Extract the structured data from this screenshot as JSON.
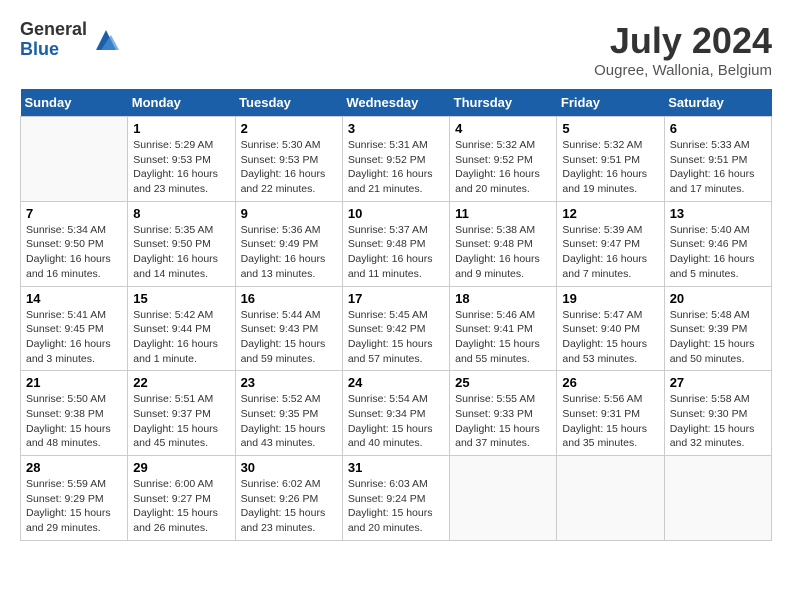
{
  "logo": {
    "general": "General",
    "blue": "Blue"
  },
  "header": {
    "title": "July 2024",
    "subtitle": "Ougree, Wallonia, Belgium"
  },
  "days_of_week": [
    "Sunday",
    "Monday",
    "Tuesday",
    "Wednesday",
    "Thursday",
    "Friday",
    "Saturday"
  ],
  "weeks": [
    [
      {
        "day": "",
        "sunrise": "",
        "sunset": "",
        "daylight": ""
      },
      {
        "day": "1",
        "sunrise": "Sunrise: 5:29 AM",
        "sunset": "Sunset: 9:53 PM",
        "daylight": "Daylight: 16 hours and 23 minutes."
      },
      {
        "day": "2",
        "sunrise": "Sunrise: 5:30 AM",
        "sunset": "Sunset: 9:53 PM",
        "daylight": "Daylight: 16 hours and 22 minutes."
      },
      {
        "day": "3",
        "sunrise": "Sunrise: 5:31 AM",
        "sunset": "Sunset: 9:52 PM",
        "daylight": "Daylight: 16 hours and 21 minutes."
      },
      {
        "day": "4",
        "sunrise": "Sunrise: 5:32 AM",
        "sunset": "Sunset: 9:52 PM",
        "daylight": "Daylight: 16 hours and 20 minutes."
      },
      {
        "day": "5",
        "sunrise": "Sunrise: 5:32 AM",
        "sunset": "Sunset: 9:51 PM",
        "daylight": "Daylight: 16 hours and 19 minutes."
      },
      {
        "day": "6",
        "sunrise": "Sunrise: 5:33 AM",
        "sunset": "Sunset: 9:51 PM",
        "daylight": "Daylight: 16 hours and 17 minutes."
      }
    ],
    [
      {
        "day": "7",
        "sunrise": "Sunrise: 5:34 AM",
        "sunset": "Sunset: 9:50 PM",
        "daylight": "Daylight: 16 hours and 16 minutes."
      },
      {
        "day": "8",
        "sunrise": "Sunrise: 5:35 AM",
        "sunset": "Sunset: 9:50 PM",
        "daylight": "Daylight: 16 hours and 14 minutes."
      },
      {
        "day": "9",
        "sunrise": "Sunrise: 5:36 AM",
        "sunset": "Sunset: 9:49 PM",
        "daylight": "Daylight: 16 hours and 13 minutes."
      },
      {
        "day": "10",
        "sunrise": "Sunrise: 5:37 AM",
        "sunset": "Sunset: 9:48 PM",
        "daylight": "Daylight: 16 hours and 11 minutes."
      },
      {
        "day": "11",
        "sunrise": "Sunrise: 5:38 AM",
        "sunset": "Sunset: 9:48 PM",
        "daylight": "Daylight: 16 hours and 9 minutes."
      },
      {
        "day": "12",
        "sunrise": "Sunrise: 5:39 AM",
        "sunset": "Sunset: 9:47 PM",
        "daylight": "Daylight: 16 hours and 7 minutes."
      },
      {
        "day": "13",
        "sunrise": "Sunrise: 5:40 AM",
        "sunset": "Sunset: 9:46 PM",
        "daylight": "Daylight: 16 hours and 5 minutes."
      }
    ],
    [
      {
        "day": "14",
        "sunrise": "Sunrise: 5:41 AM",
        "sunset": "Sunset: 9:45 PM",
        "daylight": "Daylight: 16 hours and 3 minutes."
      },
      {
        "day": "15",
        "sunrise": "Sunrise: 5:42 AM",
        "sunset": "Sunset: 9:44 PM",
        "daylight": "Daylight: 16 hours and 1 minute."
      },
      {
        "day": "16",
        "sunrise": "Sunrise: 5:44 AM",
        "sunset": "Sunset: 9:43 PM",
        "daylight": "Daylight: 15 hours and 59 minutes."
      },
      {
        "day": "17",
        "sunrise": "Sunrise: 5:45 AM",
        "sunset": "Sunset: 9:42 PM",
        "daylight": "Daylight: 15 hours and 57 minutes."
      },
      {
        "day": "18",
        "sunrise": "Sunrise: 5:46 AM",
        "sunset": "Sunset: 9:41 PM",
        "daylight": "Daylight: 15 hours and 55 minutes."
      },
      {
        "day": "19",
        "sunrise": "Sunrise: 5:47 AM",
        "sunset": "Sunset: 9:40 PM",
        "daylight": "Daylight: 15 hours and 53 minutes."
      },
      {
        "day": "20",
        "sunrise": "Sunrise: 5:48 AM",
        "sunset": "Sunset: 9:39 PM",
        "daylight": "Daylight: 15 hours and 50 minutes."
      }
    ],
    [
      {
        "day": "21",
        "sunrise": "Sunrise: 5:50 AM",
        "sunset": "Sunset: 9:38 PM",
        "daylight": "Daylight: 15 hours and 48 minutes."
      },
      {
        "day": "22",
        "sunrise": "Sunrise: 5:51 AM",
        "sunset": "Sunset: 9:37 PM",
        "daylight": "Daylight: 15 hours and 45 minutes."
      },
      {
        "day": "23",
        "sunrise": "Sunrise: 5:52 AM",
        "sunset": "Sunset: 9:35 PM",
        "daylight": "Daylight: 15 hours and 43 minutes."
      },
      {
        "day": "24",
        "sunrise": "Sunrise: 5:54 AM",
        "sunset": "Sunset: 9:34 PM",
        "daylight": "Daylight: 15 hours and 40 minutes."
      },
      {
        "day": "25",
        "sunrise": "Sunrise: 5:55 AM",
        "sunset": "Sunset: 9:33 PM",
        "daylight": "Daylight: 15 hours and 37 minutes."
      },
      {
        "day": "26",
        "sunrise": "Sunrise: 5:56 AM",
        "sunset": "Sunset: 9:31 PM",
        "daylight": "Daylight: 15 hours and 35 minutes."
      },
      {
        "day": "27",
        "sunrise": "Sunrise: 5:58 AM",
        "sunset": "Sunset: 9:30 PM",
        "daylight": "Daylight: 15 hours and 32 minutes."
      }
    ],
    [
      {
        "day": "28",
        "sunrise": "Sunrise: 5:59 AM",
        "sunset": "Sunset: 9:29 PM",
        "daylight": "Daylight: 15 hours and 29 minutes."
      },
      {
        "day": "29",
        "sunrise": "Sunrise: 6:00 AM",
        "sunset": "Sunset: 9:27 PM",
        "daylight": "Daylight: 15 hours and 26 minutes."
      },
      {
        "day": "30",
        "sunrise": "Sunrise: 6:02 AM",
        "sunset": "Sunset: 9:26 PM",
        "daylight": "Daylight: 15 hours and 23 minutes."
      },
      {
        "day": "31",
        "sunrise": "Sunrise: 6:03 AM",
        "sunset": "Sunset: 9:24 PM",
        "daylight": "Daylight: 15 hours and 20 minutes."
      },
      {
        "day": "",
        "sunrise": "",
        "sunset": "",
        "daylight": ""
      },
      {
        "day": "",
        "sunrise": "",
        "sunset": "",
        "daylight": ""
      },
      {
        "day": "",
        "sunrise": "",
        "sunset": "",
        "daylight": ""
      }
    ]
  ]
}
